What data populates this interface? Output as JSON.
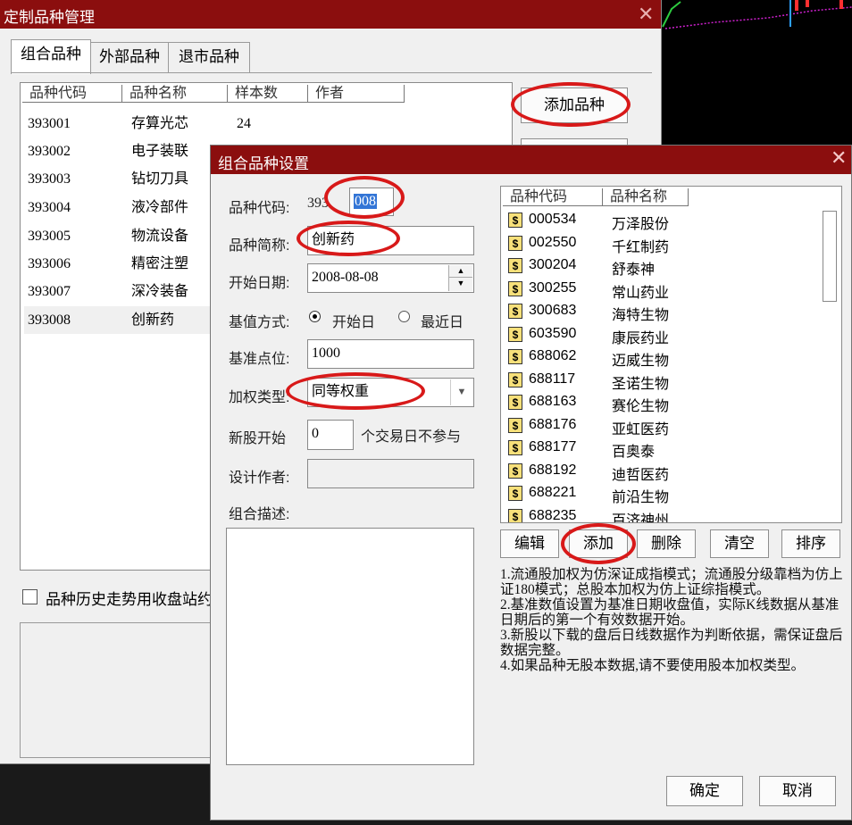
{
  "outer": {
    "title": "定制品种管理",
    "close": "✕",
    "tabs": [
      "组合品种",
      "外部品种",
      "退市品种"
    ],
    "columns": [
      "品种代码",
      "品种名称",
      "样本数",
      "作者"
    ],
    "rows": [
      {
        "code": "393001",
        "name": "存算光芯",
        "count": "24"
      },
      {
        "code": "393002",
        "name": "电子装联",
        "count": ""
      },
      {
        "code": "393003",
        "name": "钻切刀具",
        "count": ""
      },
      {
        "code": "393004",
        "name": "液冷部件",
        "count": ""
      },
      {
        "code": "393005",
        "name": "物流设备",
        "count": ""
      },
      {
        "code": "393006",
        "name": "精密注塑",
        "count": ""
      },
      {
        "code": "393007",
        "name": "深冷装备",
        "count": ""
      },
      {
        "code": "393008",
        "name": "创新药",
        "count": ""
      }
    ],
    "add_button": "添加品种",
    "history_checkbox_label": "品种历史走势用收盘站约"
  },
  "dialog": {
    "title": "组合品种设置",
    "close": "✕",
    "code_label": "品种代码:",
    "code_prefix": "393",
    "code_value": "008",
    "short_name_label": "品种简称:",
    "short_name_value": "创新药",
    "start_date_label": "开始日期:",
    "start_date_value": "2008-08-08",
    "base_mode_label": "基值方式:",
    "base_mode_options": [
      "开始日",
      "最近日"
    ],
    "base_mode_selected": "开始日",
    "base_point_label": "基准点位:",
    "base_point_value": "1000",
    "weight_label": "加权类型:",
    "weight_value": "同等权重",
    "new_stock_label": "新股开始",
    "new_stock_value": "0",
    "new_stock_suffix": "个交易日不参与",
    "author_label": "设计作者:",
    "author_value": "",
    "desc_label": "组合描述:",
    "desc_value": "",
    "stock_columns": [
      "品种代码",
      "品种名称"
    ],
    "stocks": [
      {
        "code": "000534",
        "name": "万泽股份"
      },
      {
        "code": "002550",
        "name": "千红制药"
      },
      {
        "code": "300204",
        "name": "舒泰神"
      },
      {
        "code": "300255",
        "name": "常山药业"
      },
      {
        "code": "300683",
        "name": "海特生物"
      },
      {
        "code": "603590",
        "name": "康辰药业"
      },
      {
        "code": "688062",
        "name": "迈威生物"
      },
      {
        "code": "688117",
        "name": "圣诺生物"
      },
      {
        "code": "688163",
        "name": "赛伦生物"
      },
      {
        "code": "688176",
        "name": "亚虹医药"
      },
      {
        "code": "688177",
        "name": "百奥泰"
      },
      {
        "code": "688192",
        "name": "迪哲医药"
      },
      {
        "code": "688221",
        "name": "前沿生物"
      },
      {
        "code": "688235",
        "name": "百济神州"
      }
    ],
    "stock_icon": "$",
    "buttons": {
      "edit": "编辑",
      "add": "添加",
      "delete": "删除",
      "clear": "清空",
      "sort": "排序"
    },
    "notes": [
      "1.流通股加权为仿深证成指模式；流通股分级靠档为仿上证180模式；总股本加权为仿上证综指模式。",
      "2.基准数值设置为基准日期收盘值，实际K线数据从基准日期后的第一个有效数据开始。",
      "3.新股以下载的盘后日线数据作为判断依据，需保证盘后数据完整。",
      "4.如果品种无股本数据,请不要使用股本加权类型。"
    ],
    "ok": "确定",
    "cancel": "取消"
  },
  "colors": {
    "title_bar": "#8b0e0e",
    "highlight_ring": "#d81919",
    "selection": "#3375d6"
  }
}
